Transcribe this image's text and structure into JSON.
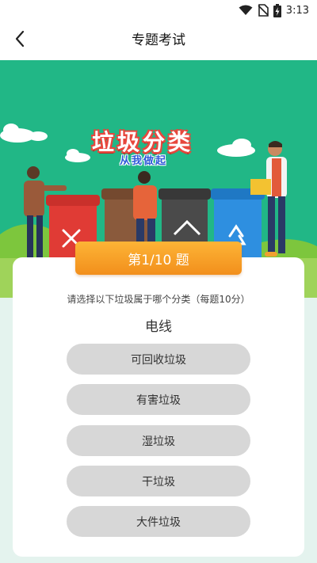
{
  "status_bar": {
    "time": "3:13",
    "icons": [
      "wifi-icon",
      "no-sim-icon",
      "battery-charging-icon"
    ]
  },
  "app_bar": {
    "title": "专题考试",
    "back_icon": "chevron-left-icon"
  },
  "banner": {
    "title": "垃圾分类",
    "subtitle": "从我做起",
    "bin_colors": [
      "#e03b35",
      "#8a5a3c",
      "#4a4a4a",
      "#2e8fe0"
    ],
    "background_color": "#21b786"
  },
  "quiz": {
    "progress_label": "第1/10 题",
    "current_question": 1,
    "total_questions": 10,
    "instruction": "请选择以下垃圾属于哪个分类（每题10分）",
    "item_name": "电线",
    "options": [
      {
        "label": "可回收垃圾"
      },
      {
        "label": "有害垃圾"
      },
      {
        "label": "湿垃圾"
      },
      {
        "label": "干垃圾"
      },
      {
        "label": "大件垃圾"
      }
    ]
  },
  "colors": {
    "accent_orange": "#f5a026",
    "option_background": "#d7d7d7",
    "page_background": "#e4f3ee"
  }
}
